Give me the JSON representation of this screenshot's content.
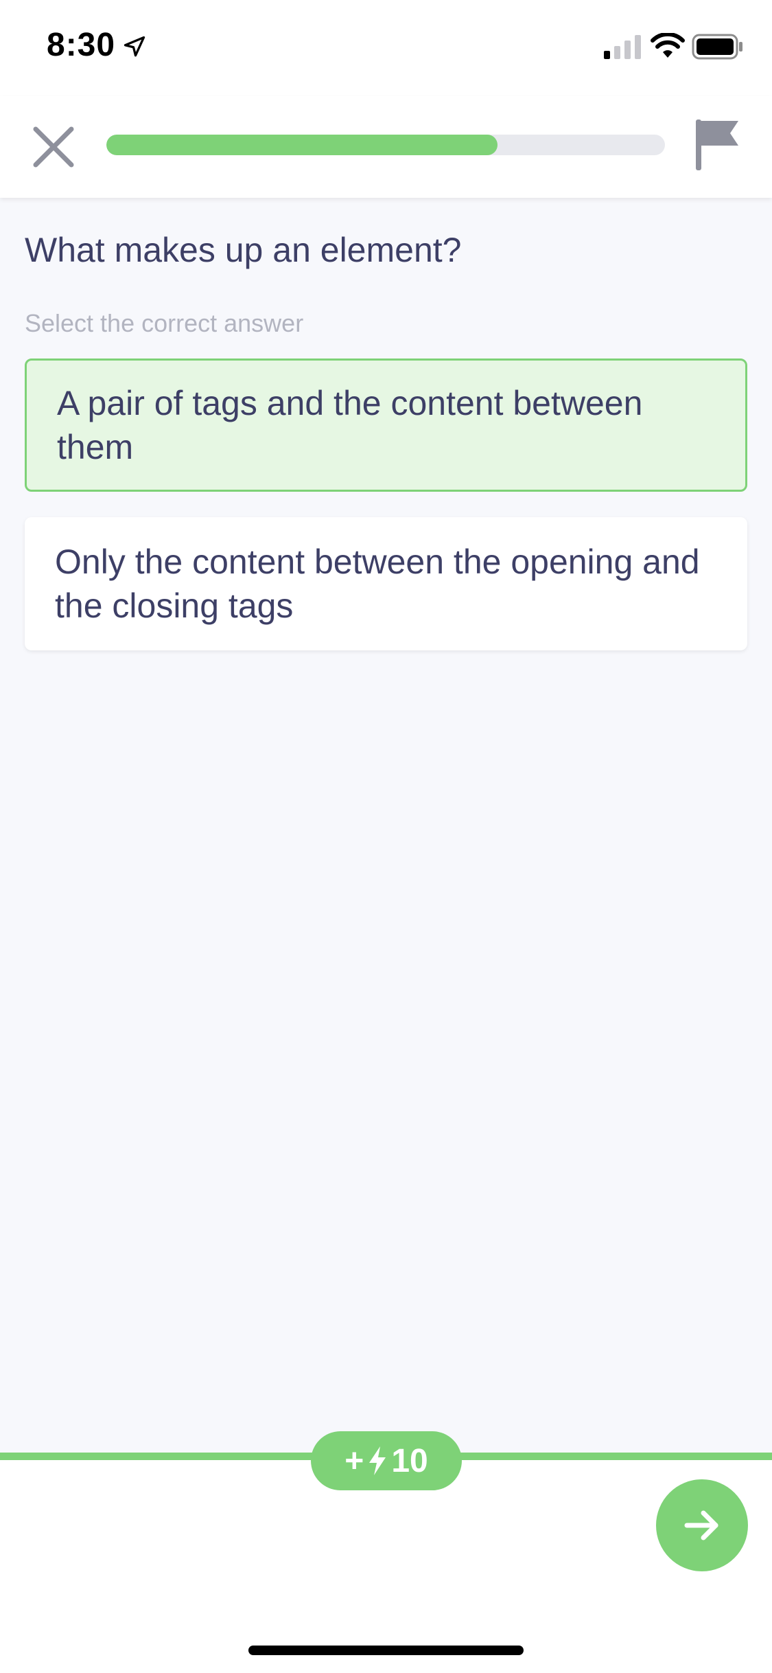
{
  "status_bar": {
    "time": "8:30"
  },
  "header": {
    "progress_fraction": 0.7
  },
  "question": {
    "title": "What makes up an element?",
    "instruction": "Select the correct answer"
  },
  "answers": [
    {
      "label": "A pair of tags and the content between them",
      "selected": true
    },
    {
      "label": "Only the content between the opening and the closing tags",
      "selected": false
    }
  ],
  "footer": {
    "reward_plus": "+",
    "reward_value": "10",
    "reward_icon": "lightning-bolt-icon",
    "next_icon": "arrow-right-icon"
  },
  "colors": {
    "accent": "#7ed277",
    "selected_bg": "#e6f7e3",
    "text": "#3d3f66",
    "muted": "#b2b4c0"
  }
}
